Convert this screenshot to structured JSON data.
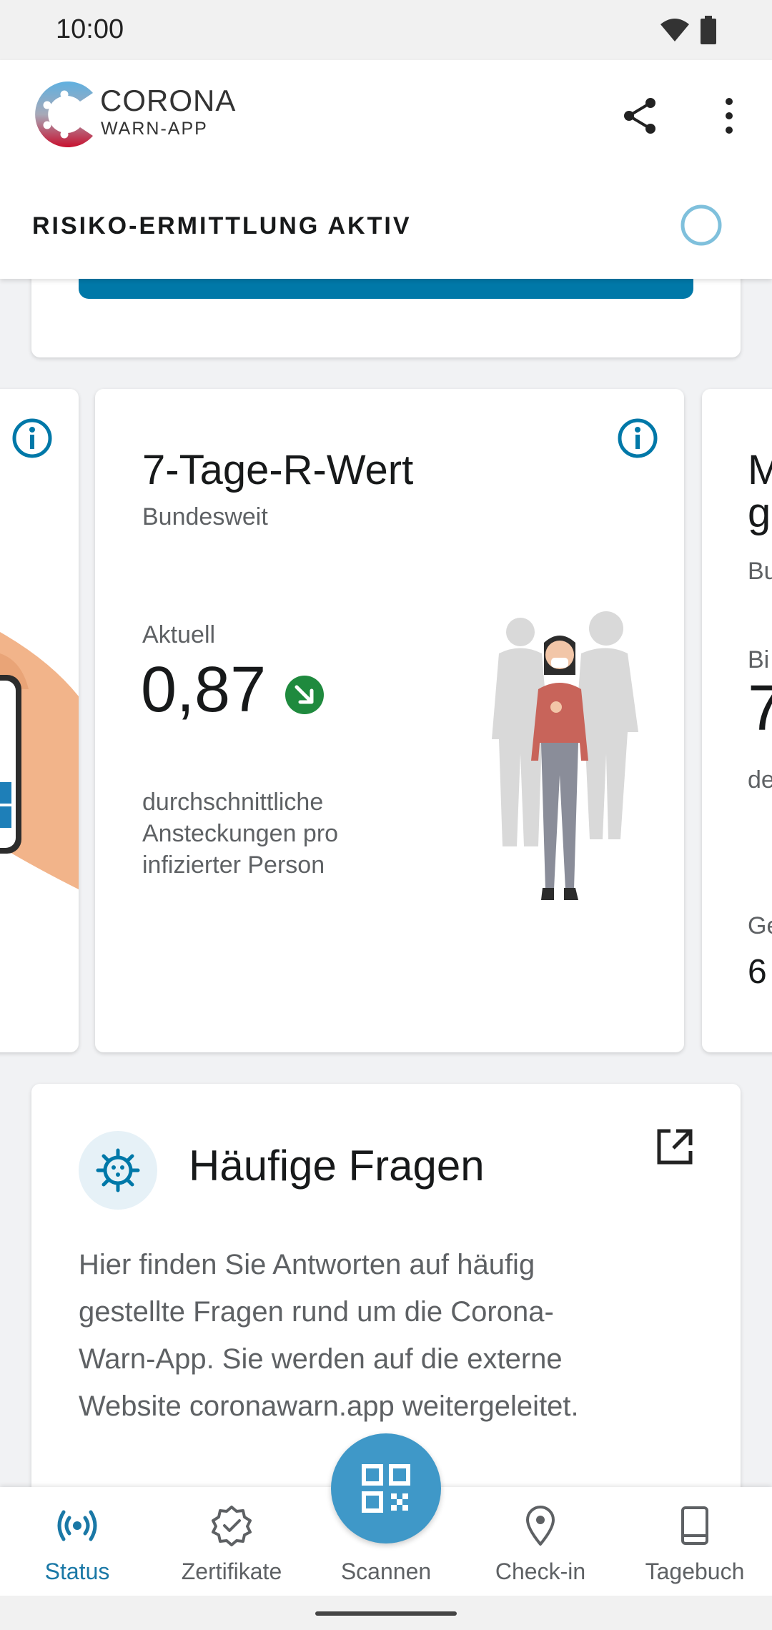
{
  "status_bar": {
    "time": "10:00"
  },
  "app": {
    "brand_line1": "CORONA",
    "brand_line2": "WARN-APP"
  },
  "risk": {
    "label": "RISIKO-ERMITTLUNG AKTIV"
  },
  "stats": {
    "main": {
      "title": "7-Tage-R-Wert",
      "subtitle": "Bundesweit",
      "label": "Aktuell",
      "value": "0,87",
      "trend": "down",
      "description": "durchschnittliche Ansteckungen pro infizierter Person"
    },
    "right_partial": {
      "title_line1": "M",
      "title_line2": "g",
      "subtitle": "Bu",
      "label": "Bi",
      "value": "7",
      "desc": "de",
      "footer_label": "Ge",
      "footer_value": "6"
    }
  },
  "faq": {
    "title": "Häufige Fragen",
    "body": "Hier finden Sie Antworten auf häufig gestellte Fragen rund um die Corona-Warn-App. Sie werden auf die externe Website coronawarn.app weitergeleitet."
  },
  "nav": {
    "items": [
      {
        "label": "Status",
        "icon": "broadcast-icon",
        "active": true
      },
      {
        "label": "Zertifikate",
        "icon": "certificate-icon",
        "active": false
      },
      {
        "label": "Scannen",
        "icon": "qr-code-icon",
        "active": false
      },
      {
        "label": "Check-in",
        "icon": "location-pin-icon",
        "active": false
      },
      {
        "label": "Tagebuch",
        "icon": "book-icon",
        "active": false
      }
    ]
  },
  "colors": {
    "accent": "#0078a8",
    "fab": "#3f98c8",
    "trend_down": "#1f8a3e",
    "active_nav": "#1a78a6"
  }
}
